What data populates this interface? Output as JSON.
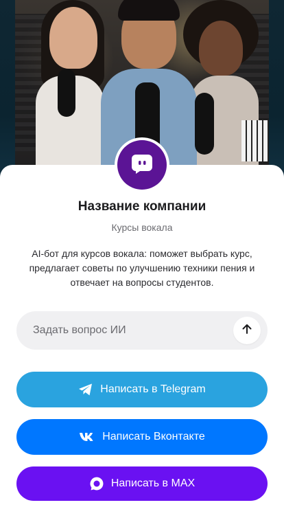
{
  "colors": {
    "telegram": "#2aa3df",
    "vk": "#0077ff",
    "max": "#6a11f2",
    "avatar": "#5b1495"
  },
  "company": {
    "name": "Название компании",
    "subtitle": "Курсы вокала",
    "description": "AI-бот для курсов вокала: поможет выбрать курс, предлагает советы по улучшению техники пения и отвечает на вопросы студентов.",
    "avatar_icon": "chat-bot-icon"
  },
  "ask": {
    "placeholder": "Задать вопрос ИИ",
    "value": "",
    "send_icon": "arrow-up-icon"
  },
  "buttons": {
    "telegram": {
      "label": "Написать в Telegram",
      "icon": "telegram-icon"
    },
    "vk": {
      "label": "Написать Вконтакте",
      "icon": "vk-icon"
    },
    "max": {
      "label": "Написать в MAX",
      "icon": "max-icon"
    }
  },
  "hero": {
    "image": "hero-photo"
  }
}
